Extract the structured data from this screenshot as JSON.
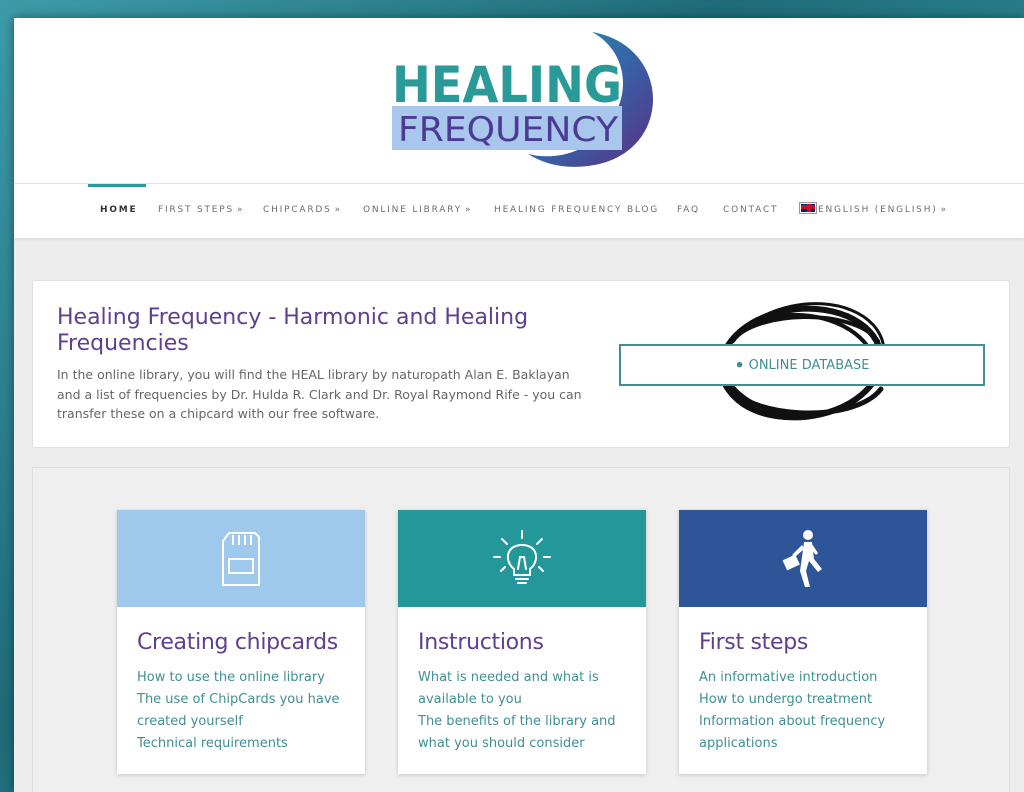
{
  "logo": {
    "line1": "HEALING",
    "line2": "FREQUENCY"
  },
  "nav": {
    "items": [
      {
        "label": "HOME",
        "active": true
      },
      {
        "label": "FIRST STEPS",
        "chevron": true
      },
      {
        "label": "CHIPCARDS",
        "chevron": true
      },
      {
        "label": "ONLINE LIBRARY",
        "chevron": true
      },
      {
        "label": "HEALING FREQUENCY BLOG"
      },
      {
        "label": "FAQ"
      },
      {
        "label": "CONTACT"
      },
      {
        "label": "ENGLISH (ENGLISH)",
        "chevron": true,
        "icon": "uk-flag-icon"
      }
    ],
    "chevron_glyph": "»"
  },
  "hero": {
    "title": "Healing Frequency - Harmonic and Healing Frequencies",
    "text": "In the online library, you will find the HEAL library by naturopath Alan E. Baklayan and a list of frequencies by Dr. Hulda R. Clark and Dr. Royal Raymond Rife - you can transfer these on a chipcard with our free software.",
    "button_label": "ONLINE DATABASE",
    "button_icon": "lightbulb-icon"
  },
  "cards": [
    {
      "title": "Creating chipcards",
      "icon": "sd-card-icon",
      "color": "#9ec8ec",
      "links": [
        "How to use the online library",
        "The use of ChipCards you have created yourself",
        "Technical requirements"
      ]
    },
    {
      "title": "Instructions",
      "icon": "lightbulb-icon",
      "color": "#23979a",
      "links": [
        "What is needed and what is available to you",
        "The benefits of the library and what you should consider"
      ]
    },
    {
      "title": "First steps",
      "icon": "walking-man-icon",
      "color": "#2e5597",
      "links": [
        "An informative introduction",
        "How to undergo treatment",
        "Information about frequency applications"
      ]
    }
  ],
  "colors": {
    "accent": "#2a9a98",
    "title_purple": "#5f3f8f",
    "link_teal": "#3f8f94"
  }
}
